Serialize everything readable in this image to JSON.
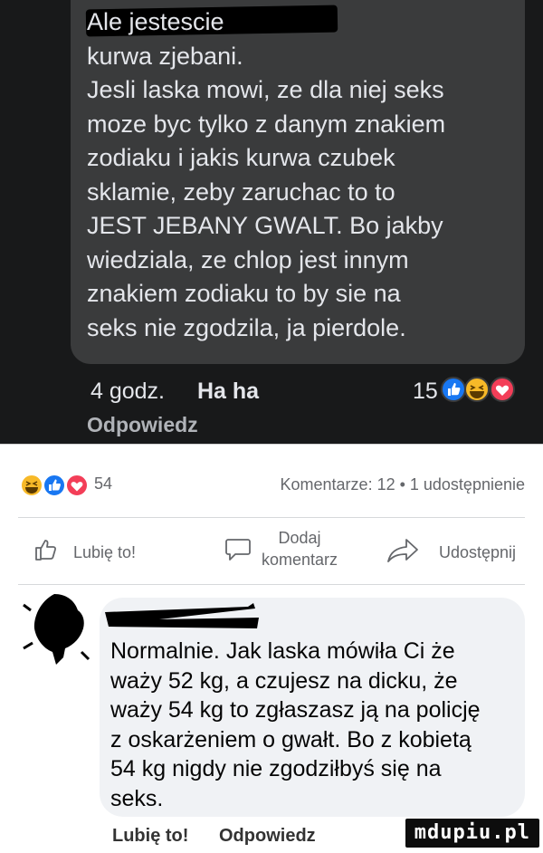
{
  "top_comment": {
    "text": "Ale jestescie\nkurwa zjebani.\nJesli laska mowi, ze dla niej seks\nmoze byc tylko z danym znakiem\nzodiaku i jakis kurwa czubek\nsklamie, zeby zaruchac to to\nJEST JEBANY GWALT. Bo jakby\nwiedziala, ze chlop jest innym\nznakiem zodiaku to by sie na\nseks nie zgodzila, ja pierdole.",
    "time": "4 godz.",
    "reaction_label": "Ha ha",
    "reaction_count": "15",
    "reaction_icons": [
      "thumbs-up-icon",
      "laugh-icon",
      "heart-icon"
    ],
    "reply_label": "Odpowiedz"
  },
  "post_stats": {
    "reaction_icons": [
      "laugh-icon",
      "thumbs-up-icon",
      "heart-icon"
    ],
    "reaction_count": "54",
    "summary": "Komentarze: 12 • 1 udostępnienie"
  },
  "actions": {
    "like": "Lubię to!",
    "comment": "Dodaj komentarz",
    "share": "Udostępnij"
  },
  "bottom_comment": {
    "text": "Normalnie. Jak laska mówiła Ci że\nważy 52 kg, a czujesz na dicku, że\nważy 54 kg to zgłaszasz ją na policję\nz oskarżeniem o gwałt. Bo z kobietą\n54 kg nigdy nie zgodziłbyś się na\nseks.",
    "like_label": "Lubię to!",
    "reply_label": "Odpowiedz"
  },
  "watermark": {
    "text": "mdupiu.pl"
  },
  "colors": {
    "dark_bg": "#18191a",
    "dark_bubble": "#3a3b3c",
    "fb_blue": "#1877f2",
    "heart_red": "#f33e58",
    "laugh_yellow": "#f7b928"
  }
}
